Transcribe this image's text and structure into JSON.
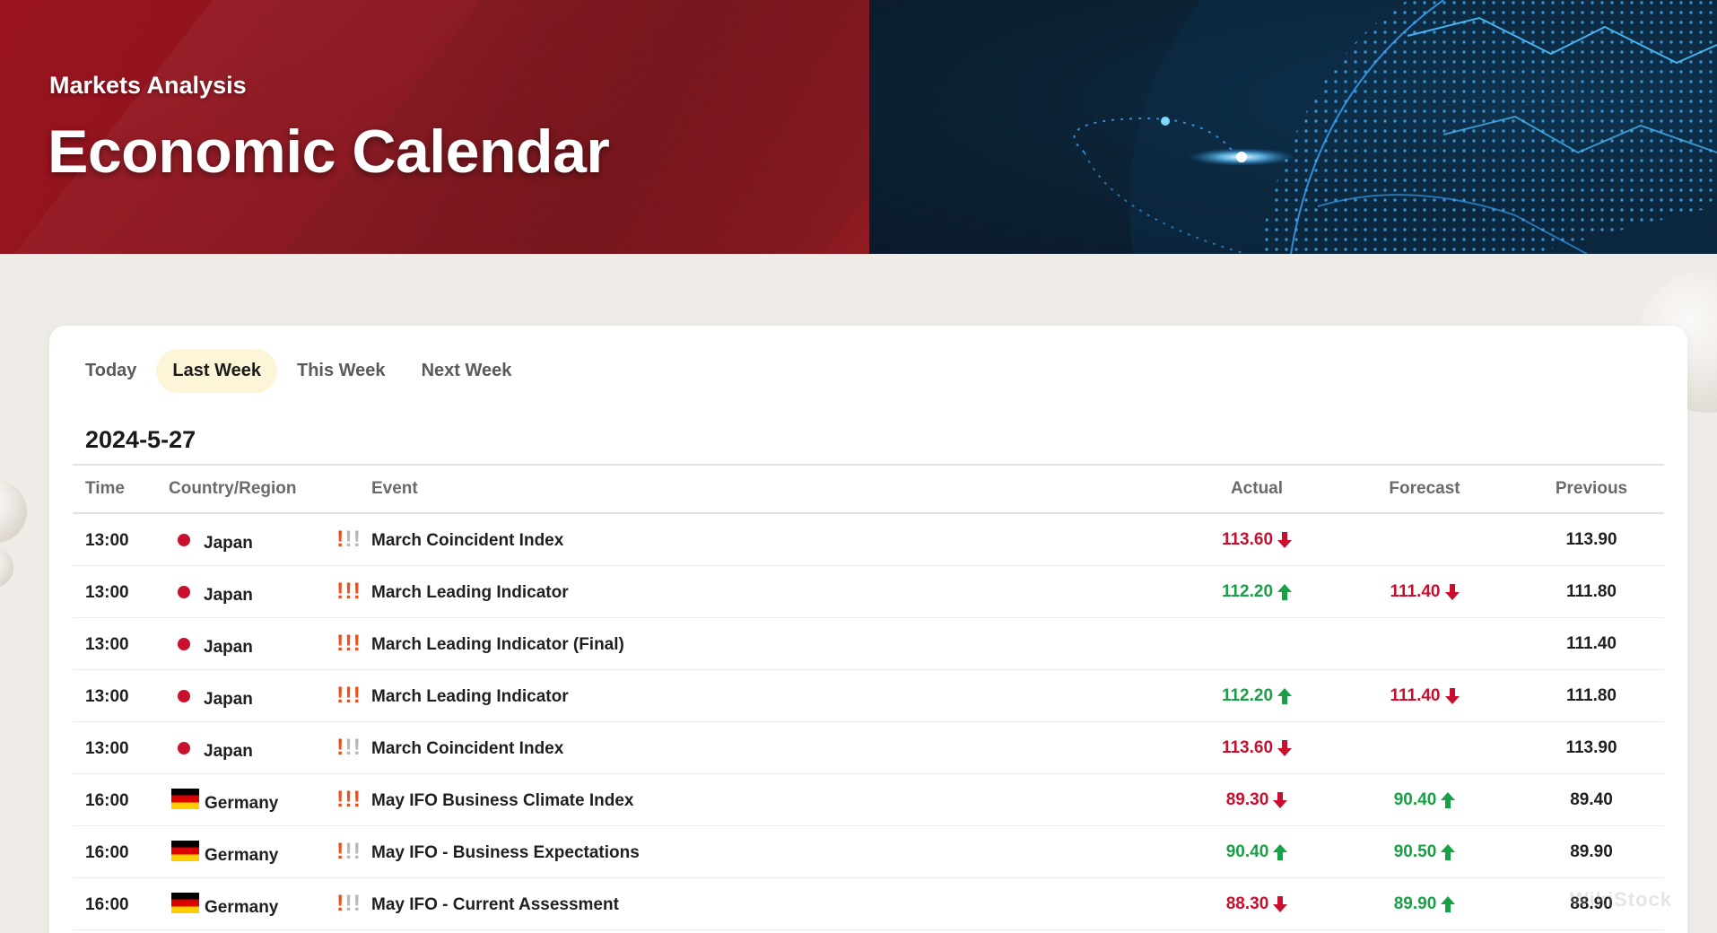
{
  "hero": {
    "subtitle": "Markets Analysis",
    "title": "Economic Calendar"
  },
  "tabs": [
    {
      "label": "Today",
      "active": false
    },
    {
      "label": "Last Week",
      "active": true
    },
    {
      "label": "This Week",
      "active": false
    },
    {
      "label": "Next Week",
      "active": false
    }
  ],
  "date": "2024-5-27",
  "table": {
    "headers": {
      "time": "Time",
      "country": "Country/Region",
      "event": "Event",
      "actual": "Actual",
      "forecast": "Forecast",
      "previous": "Previous"
    },
    "rows": [
      {
        "time": "13:00",
        "country": "Japan",
        "flag": "japan-flag-icon",
        "importance": 1,
        "event": "March Coincident Index",
        "actual": {
          "value": "113.60",
          "trend": "down"
        },
        "forecast": {
          "value": "",
          "trend": ""
        },
        "previous": "113.90"
      },
      {
        "time": "13:00",
        "country": "Japan",
        "flag": "japan-flag-icon",
        "importance": 3,
        "event": "March Leading Indicator",
        "actual": {
          "value": "112.20",
          "trend": "up"
        },
        "forecast": {
          "value": "111.40",
          "trend": "down"
        },
        "previous": "111.80"
      },
      {
        "time": "13:00",
        "country": "Japan",
        "flag": "japan-flag-icon",
        "importance": 3,
        "event": "March Leading Indicator (Final)",
        "actual": {
          "value": "",
          "trend": ""
        },
        "forecast": {
          "value": "",
          "trend": ""
        },
        "previous": "111.40"
      },
      {
        "time": "13:00",
        "country": "Japan",
        "flag": "japan-flag-icon",
        "importance": 3,
        "event": "March Leading Indicator",
        "actual": {
          "value": "112.20",
          "trend": "up"
        },
        "forecast": {
          "value": "111.40",
          "trend": "down"
        },
        "previous": "111.80"
      },
      {
        "time": "13:00",
        "country": "Japan",
        "flag": "japan-flag-icon",
        "importance": 1,
        "event": "March Coincident Index",
        "actual": {
          "value": "113.60",
          "trend": "down"
        },
        "forecast": {
          "value": "",
          "trend": ""
        },
        "previous": "113.90"
      },
      {
        "time": "16:00",
        "country": "Germany",
        "flag": "germany-flag-icon",
        "importance": 3,
        "event": "May IFO Business Climate Index",
        "actual": {
          "value": "89.30",
          "trend": "down"
        },
        "forecast": {
          "value": "90.40",
          "trend": "up"
        },
        "previous": "89.40"
      },
      {
        "time": "16:00",
        "country": "Germany",
        "flag": "germany-flag-icon",
        "importance": 1,
        "event": "May IFO - Business Expectations",
        "actual": {
          "value": "90.40",
          "trend": "up"
        },
        "forecast": {
          "value": "90.50",
          "trend": "up"
        },
        "previous": "89.90"
      },
      {
        "time": "16:00",
        "country": "Germany",
        "flag": "germany-flag-icon",
        "importance": 1,
        "event": "May IFO - Current Assessment",
        "actual": {
          "value": "88.30",
          "trend": "down"
        },
        "forecast": {
          "value": "89.90",
          "trend": "up"
        },
        "previous": "88.90"
      }
    ]
  },
  "colors": {
    "brand_red": "#8a131c",
    "up_green": "#18a046",
    "down_red": "#c8102e",
    "importance_on": "#e8521c",
    "importance_off": "#b8b8b8",
    "active_tab_bg": "#fdf5d8"
  },
  "watermark": "WikiStock"
}
